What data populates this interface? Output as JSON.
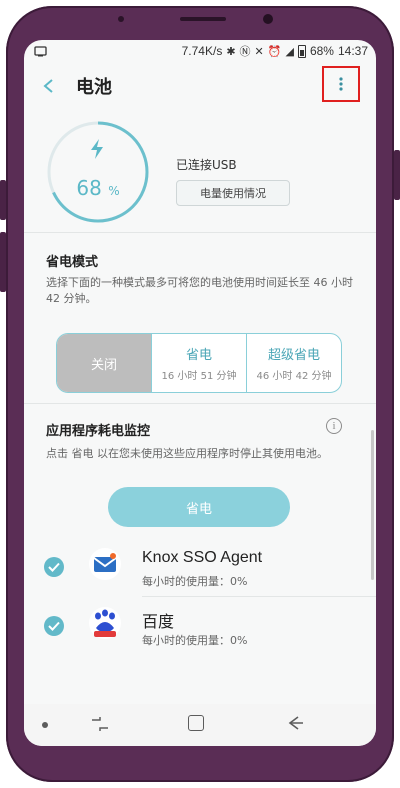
{
  "status_bar": {
    "network_speed": "7.74K/s",
    "battery": "68%",
    "time": "14:37"
  },
  "header": {
    "title": "电池",
    "back_icon": "back-arrow-icon",
    "more_icon": "more-vertical-icon"
  },
  "battery": {
    "percent_value": "68",
    "percent_sign": "%",
    "level_fraction": 0.68,
    "status": "已连接USB",
    "usage_button": "电量使用情况"
  },
  "power_saving": {
    "title": "省电模式",
    "description": "选择下面的一种模式最多可将您的电池使用时间延长至 46 小时 42 分钟。",
    "modes": [
      {
        "label": "关闭",
        "sub": ""
      },
      {
        "label": "省电",
        "sub": "16 小时 51 分钟"
      },
      {
        "label": "超级省电",
        "sub": "46 小时 42 分钟"
      }
    ]
  },
  "app_monitor": {
    "title": "应用程序耗电监控",
    "description": "点击 省电 以在您未使用这些应用程序时停止其使用电池。",
    "save_button": "省电",
    "apps": [
      {
        "name": "Knox SSO Agent",
        "usage": "每小时的使用量：0%"
      },
      {
        "name": "百度",
        "usage": "每小时的使用量：0%"
      }
    ]
  },
  "colors": {
    "accent": "#5bb8c7",
    "highlight_box": "#e0201f",
    "phone_frame": "#5a2d55"
  }
}
